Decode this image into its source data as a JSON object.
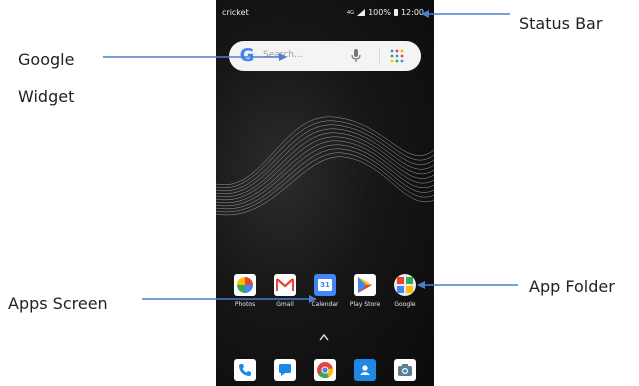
{
  "callouts": {
    "status_bar": "Status Bar",
    "google_line1": "Google",
    "google_line2": "Widget",
    "app_folder": "App Folder",
    "apps_screen": "Apps Screen"
  },
  "status_bar": {
    "carrier": "cricket",
    "network": "4G",
    "battery": "100%",
    "time": "12:00"
  },
  "search_widget": {
    "logo": "G",
    "placeholder": "Search..."
  },
  "apps": [
    {
      "label": "Photos",
      "icon": "photos-icon"
    },
    {
      "label": "Gmail",
      "icon": "gmail-icon"
    },
    {
      "label": "Calendar",
      "icon": "calendar-icon",
      "day": "31"
    },
    {
      "label": "Play Store",
      "icon": "play-store-icon"
    },
    {
      "label": "Google",
      "icon": "google-folder-icon"
    }
  ],
  "dock": [
    {
      "icon": "phone-icon"
    },
    {
      "icon": "messages-icon"
    },
    {
      "icon": "chrome-icon"
    },
    {
      "icon": "contacts-icon"
    },
    {
      "icon": "camera-icon"
    }
  ],
  "colors": {
    "arrow": "#4a7fd0",
    "wallpaper": "#141414",
    "google_blue": "#4285f4",
    "google_red": "#ea4335",
    "google_yellow": "#fbbc05",
    "google_green": "#34a853"
  }
}
